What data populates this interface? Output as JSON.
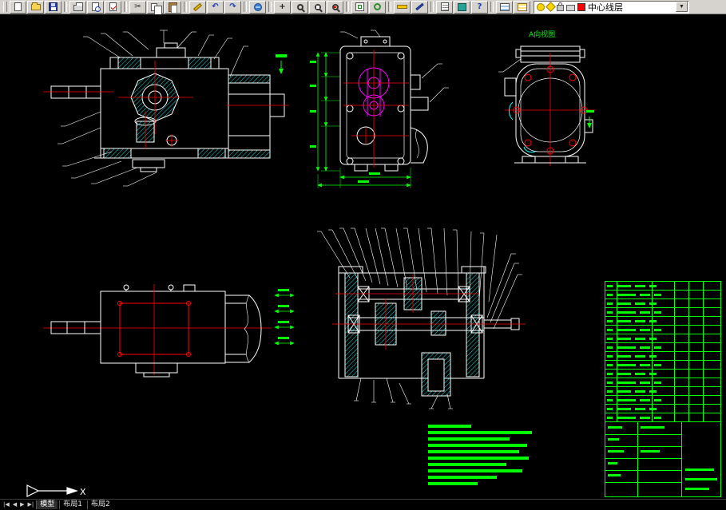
{
  "toolbar": {
    "buttons": [
      {
        "name": "new-button",
        "icon": "new-file-icon"
      },
      {
        "name": "open-button",
        "icon": "open-folder-icon"
      },
      {
        "name": "save-button",
        "icon": "save-floppy-icon"
      },
      {
        "name": "plot-button",
        "icon": "printer-icon"
      },
      {
        "name": "print-preview-button",
        "icon": "print-preview-icon"
      },
      {
        "name": "spelling-button",
        "icon": "spelling-icon"
      },
      {
        "name": "cut-button",
        "icon": "scissors-icon",
        "glyph": "✂"
      },
      {
        "name": "copy-button",
        "icon": "copy-icon"
      },
      {
        "name": "paste-button",
        "icon": "clipboard-icon"
      },
      {
        "name": "match-properties-button",
        "icon": "paintbrush-icon"
      },
      {
        "name": "undo-button",
        "icon": "undo-arrow-icon",
        "glyph": "↶"
      },
      {
        "name": "redo-button",
        "icon": "redo-arrow-icon",
        "glyph": "↷"
      },
      {
        "name": "insert-hyperlink-button",
        "icon": "globe-icon"
      },
      {
        "name": "pan-button",
        "icon": "pan-cross-icon",
        "glyph": "+"
      },
      {
        "name": "zoom-realtime-button",
        "icon": "magnifier-icon"
      },
      {
        "name": "zoom-window-button",
        "icon": "magnifier-window-icon"
      },
      {
        "name": "zoom-previous-button",
        "icon": "magnifier-previous-icon"
      },
      {
        "name": "named-views-button",
        "icon": "views-icon"
      },
      {
        "name": "orbit-button",
        "icon": "orbit-icon"
      },
      {
        "name": "distance-button",
        "icon": "ruler-icon"
      },
      {
        "name": "redraw-button",
        "icon": "pencil-icon"
      },
      {
        "name": "properties-button",
        "icon": "properties-icon"
      },
      {
        "name": "design-center-button",
        "icon": "design-center-icon"
      },
      {
        "name": "help-button",
        "icon": "help-icon",
        "glyph": "?"
      },
      {
        "name": "layers-button",
        "icon": "layers-icon"
      },
      {
        "name": "make-layer-current-button",
        "icon": "make-layer-icon"
      }
    ],
    "layer_control": {
      "current_layer": "中心线层",
      "color_swatch": "#ff0000",
      "dropdown_glyph": "▼",
      "state_icons": [
        "layer-on-bulb-icon",
        "layer-freeze-sun-icon",
        "layer-lock-icon",
        "layer-plot-icon",
        "layer-color-swatch"
      ]
    }
  },
  "canvas": {
    "background": "#000000",
    "palette": {
      "outline": "#ffffff",
      "centerline": "#ff0000",
      "hatch": "#00ffff",
      "dimension": "#00ff00",
      "gear_detail": "#ff00ff"
    },
    "labels": {
      "view_direction": "A向视图",
      "ucs_x": "X"
    }
  },
  "bottombar": {
    "nav_glyphs": {
      "first": "|◀",
      "prev": "◀",
      "next": "▶",
      "last": "▶|"
    },
    "tabs": [
      "模型",
      "布局1",
      "布局2"
    ]
  }
}
